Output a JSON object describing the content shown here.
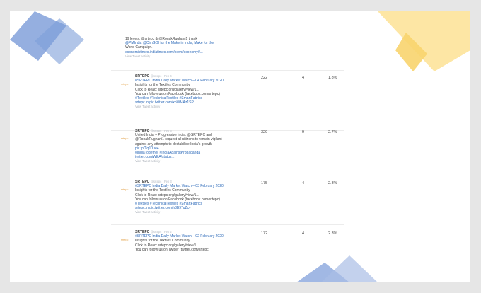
{
  "colors": {
    "blue": "#7d9fd8",
    "yellow": "#f9d97a",
    "link": "#2a68b8",
    "accent": "#e2a24a"
  },
  "top": {
    "lines": [
      {
        "text": "19 levels. @srtepc & @RonakRughani1 thank",
        "link": false
      },
      {
        "text": "@PMIndia @CimGOI for the Make in India, Make for the",
        "link": true
      },
      {
        "text": "World Campaign.",
        "link": false
      },
      {
        "text": "economictimes.indiatimes.com/news/economy/f...",
        "link": true
      }
    ],
    "meta": "View Tweet activity"
  },
  "tweets": [
    {
      "name": "SRTEPC",
      "handle": "@srtepc · Feb 4",
      "lines": [
        {
          "text": "#SRTEPC India Daily Market Watch – 04 February 2020",
          "link": true
        },
        {
          "text": "Insights for the Textiles Community",
          "link": false
        },
        {
          "text": "Click to Read: srtepc.org/gallery/view/1...",
          "link": false
        },
        {
          "text": "You can follow us on Facebook (facebook.com/srtepc)",
          "link": false
        },
        {
          "text": "#Textiles #TechnicalTextiles #SmartFabrics",
          "link": true
        },
        {
          "text": "srtepc.in pic.twitter.com/xbWMAz1SP",
          "link": true
        }
      ],
      "meta": "View Tweet activity",
      "impressions": "222",
      "engagements": "4",
      "rate": "1.8%"
    },
    {
      "name": "SRTEPC",
      "handle": "@srtepc · Feb 3",
      "lines": [
        {
          "text": "United India = Progressive India. @SRTEPC and",
          "link": false
        },
        {
          "text": "@RonakRughani1 request all citizens to remain vigilant",
          "link": false
        },
        {
          "text": "against any attempts to destabilise India's growth",
          "link": false
        },
        {
          "text": "pic.tp/TqJDue4",
          "link": true
        },
        {
          "text": "#IndiaTogether #IndiaAgainstPropaganda",
          "link": true
        },
        {
          "text": "twitter.com/WEA/status...",
          "link": true
        }
      ],
      "meta": "View Tweet activity",
      "impressions": "329",
      "engagements": "9",
      "rate": "2.7%"
    },
    {
      "name": "SRTEPC",
      "handle": "@srtepc · Feb 3",
      "lines": [
        {
          "text": "#SRTEPC India Daily Market Watch – 03 February 2020",
          "link": true
        },
        {
          "text": "Insights for the Textiles Community",
          "link": false
        },
        {
          "text": "Click to Read: srtepc.org/gallery/view/1...",
          "link": false
        },
        {
          "text": "You can follow us on Facebook (facebook.com/srtepc)",
          "link": false
        },
        {
          "text": "#Textiles #TechnicalTextiles #SmartFabrics",
          "link": true
        },
        {
          "text": "srtepc.in pic.twitter.com/h8B97uZcv",
          "link": true
        }
      ],
      "meta": "View Tweet activity",
      "impressions": "175",
      "engagements": "4",
      "rate": "2.3%"
    },
    {
      "name": "SRTEPC",
      "handle": "@srtepc · Feb 2",
      "lines": [
        {
          "text": "#SRTEPC India Daily Market Watch – 02 February 2020",
          "link": true
        },
        {
          "text": "Insights for the Textiles Community",
          "link": false
        },
        {
          "text": "Click to Read: srtepc.org/gallery/view/1...",
          "link": false
        },
        {
          "text": "You can follow us on Twitter (twitter.com/srtepc)",
          "link": false
        }
      ],
      "meta": "",
      "impressions": "172",
      "engagements": "4",
      "rate": "2.3%"
    }
  ]
}
